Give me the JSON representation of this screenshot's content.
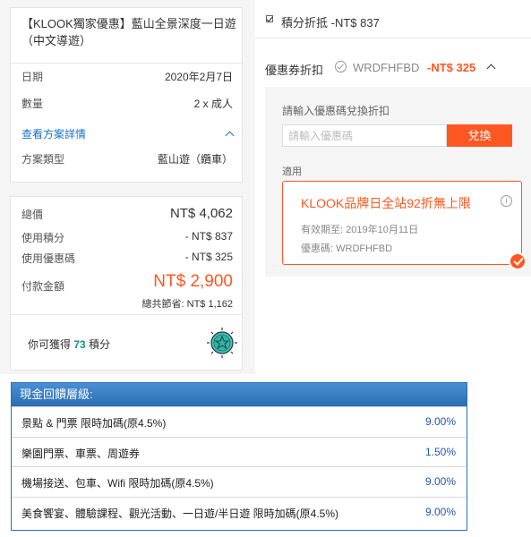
{
  "order": {
    "product_title": "【KLOOK獨家優惠】藍山全景深度一日遊（中文導遊）",
    "date_label": "日期",
    "date_value": "2020年2月7日",
    "qty_label": "數量",
    "qty_value": "2 x 成人",
    "details_link": "查看方案詳情",
    "plan_type_label": "方案類型",
    "plan_type_value": "藍山遊（纜車）"
  },
  "price": {
    "total_label": "總價",
    "total_value": "NT$ 4,062",
    "points_used_label": "使用積分",
    "points_used_value": "- NT$ 837",
    "coupon_used_label": "使用優惠碼",
    "coupon_used_value": "- NT$ 325",
    "pay_label": "付款金額",
    "pay_value": "NT$ 2,900",
    "savings": "總共節省: NT$ 1,162",
    "earn_prefix": "你可獲得",
    "earn_points": "73",
    "earn_suffix": "積分",
    "badge_icon": "star-badge-icon"
  },
  "points_deduct": {
    "checked": true,
    "label": "積分折抵 -NT$ 837"
  },
  "coupon": {
    "label": "優惠券折扣",
    "code": "WRDFHFBD",
    "discount": "-NT$ 325",
    "enter_label": "請輸入優惠碼兌換折扣",
    "input_placeholder": "請輸入優惠碼",
    "redeem_button": "兌換",
    "applicable_label": "適用",
    "card_title": "KLOOK品牌日全站92折無上限",
    "card_valid": "有效期至: 2019年10月11日",
    "card_code": "優惠碼: WRDFHFBD",
    "accent_color": "#ff5722"
  },
  "cashback": {
    "header": "現金回饋層級:",
    "rows": [
      {
        "category": "景點 & 門票 限時加碼(原4.5%)",
        "rate": "9.00%"
      },
      {
        "category": "樂園門票、車票、周遊券",
        "rate": "1.50%"
      },
      {
        "category": "機場接送、包車、Wifi 限時加碼(原4.5%)",
        "rate": "9.00%"
      },
      {
        "category": "美食饗宴、體驗課程、觀光活動、一日遊/半日遊 限時加碼(原4.5%)",
        "rate": "9.00%"
      }
    ],
    "header_color": "#2a6db3",
    "rate_color": "#2256b8"
  }
}
